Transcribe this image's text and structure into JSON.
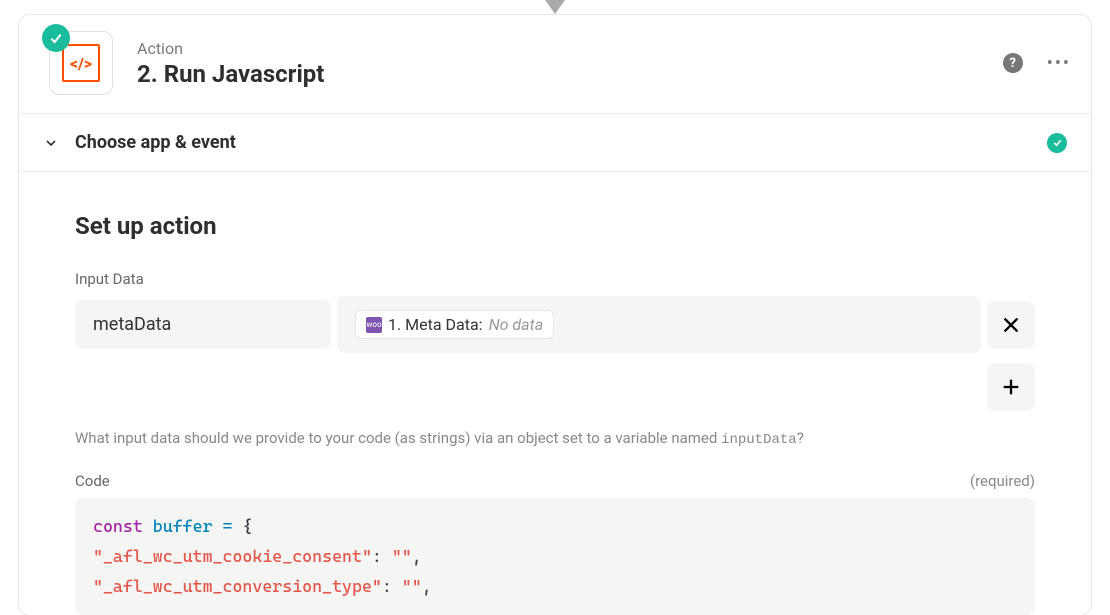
{
  "header": {
    "action_label": "Action",
    "title": "2. Run Javascript",
    "code_icon_text": "</>"
  },
  "section": {
    "choose_label": "Choose app & event"
  },
  "setup": {
    "title": "Set up action",
    "input_data_label": "Input Data",
    "input_key": "metaData",
    "pill_prefix": "1. Meta Data:",
    "pill_value": "No data",
    "hint_before": "What input data should we provide to your code (as strings) via an object set to a variable named ",
    "hint_code": "inputData",
    "hint_after": "?",
    "code_label": "Code",
    "required_label": "(required)"
  },
  "code": {
    "line1_kw": "const",
    "line1_var": "buffer",
    "line1_op": "=",
    "line1_brace": "{",
    "line2_key": "\"_afl_wc_utm_cookie_consent\"",
    "line2_val": "\"\"",
    "line3_key": "\"_afl_wc_utm_conversion_type\"",
    "line3_val": "\"\"",
    "colon": ": ",
    "comma": ","
  }
}
